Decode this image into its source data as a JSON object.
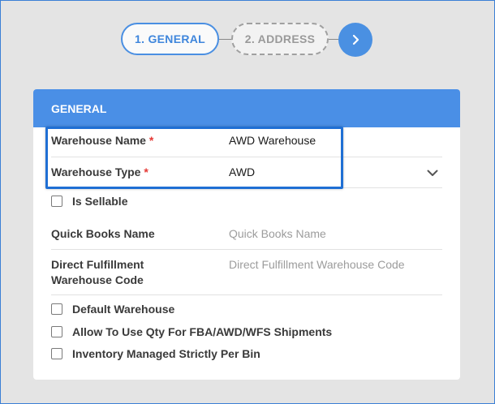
{
  "wizard": {
    "step1_label": "1. GENERAL",
    "step2_label": "2. ADDRESS",
    "next_icon": "chevron-right-icon"
  },
  "card": {
    "header": "GENERAL",
    "warehouse_name": {
      "label": "Warehouse Name",
      "required_mark": "*",
      "value": "AWD Warehouse"
    },
    "warehouse_type": {
      "label": "Warehouse Type",
      "required_mark": "*",
      "value": "AWD",
      "dropdown_icon": "chevron-down-icon"
    },
    "is_sellable": {
      "label": "Is Sellable",
      "checked": false
    },
    "quickbooks_name": {
      "label": "Quick Books Name",
      "placeholder": "Quick Books Name"
    },
    "direct_fulfillment": {
      "label_line1": "Direct Fulfillment",
      "label_line2": "Warehouse Code",
      "placeholder": "Direct Fulfillment Warehouse Code"
    },
    "default_warehouse": {
      "label": "Default Warehouse",
      "checked": false
    },
    "allow_qty": {
      "label": "Allow To Use Qty For FBA/AWD/WFS Shipments",
      "checked": false
    },
    "inventory_per_bin": {
      "label": "Inventory Managed Strictly Per Bin",
      "checked": false
    }
  },
  "colors": {
    "accent": "#4a8fe6",
    "required": "#e53935",
    "highlight": "#1f6fd4"
  }
}
